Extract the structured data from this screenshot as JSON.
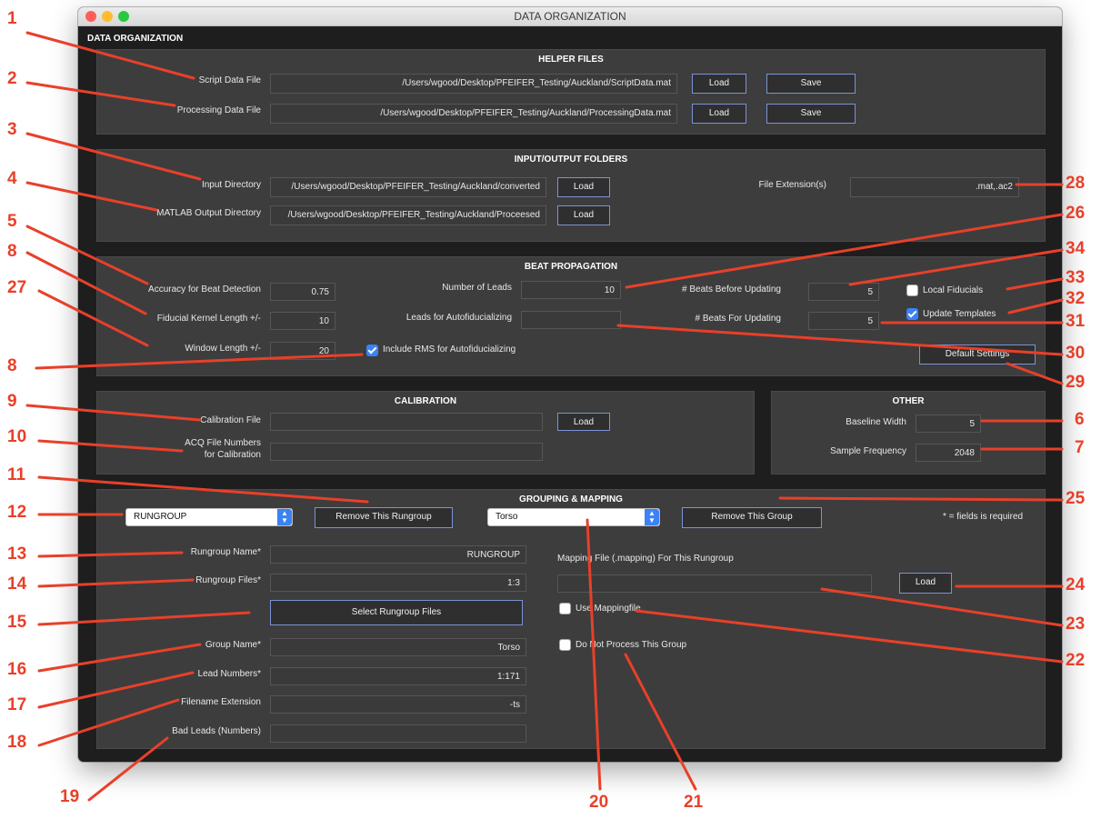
{
  "window": {
    "title": "DATA ORGANIZATION",
    "heading": "DATA ORGANIZATION"
  },
  "helper_files": {
    "title": "HELPER FILES",
    "script_label": "Script Data File",
    "script_path": "/Users/wgood/Desktop/PFEIFER_Testing/Auckland/ScriptData.mat",
    "processing_label": "Processing Data File",
    "processing_path": "/Users/wgood/Desktop/PFEIFER_Testing/Auckland/ProcessingData.mat",
    "load_label": "Load",
    "save_label": "Save"
  },
  "io_folders": {
    "title": "INPUT/OUTPUT FOLDERS",
    "input_label": "Input Directory",
    "input_path": "/Users/wgood/Desktop/PFEIFER_Testing/Auckland/converted",
    "output_label": "MATLAB Output Directory",
    "output_path": "/Users/wgood/Desktop/PFEIFER_Testing/Auckland/Proceesed",
    "ext_label": "File Extension(s)",
    "ext_value": ".mat,.ac2",
    "load_label": "Load"
  },
  "beat": {
    "title": "BEAT PROPAGATION",
    "accuracy_label": "Accuracy for Beat Detection",
    "accuracy_value": "0.75",
    "kernel_label": "Fiducial Kernel Length +/-",
    "kernel_value": "10",
    "window_label": "Window Length +/-",
    "window_value": "20",
    "leads_label": "Number of Leads",
    "leads_value": "10",
    "autofid_label": "Leads for Autofiducializing",
    "autofid_value": "",
    "rms_label": "Include RMS for Autofiducializing",
    "before_label": "# Beats Before Updating",
    "before_value": "5",
    "for_label": "# Beats For Updating",
    "for_value": "5",
    "local_label": "Local Fiducials",
    "update_label": "Update Templates",
    "default_label": "Default Settings"
  },
  "calibration": {
    "title": "CALIBRATION",
    "file_label": "Calibration File",
    "acq_label_1": "ACQ File Numbers",
    "acq_label_2": "for Calibration",
    "load_label": "Load"
  },
  "other": {
    "title": "OTHER",
    "baseline_label": "Baseline Width",
    "baseline_value": "5",
    "freq_label": "Sample Frequency",
    "freq_value": "2048"
  },
  "grouping": {
    "title": "GROUPING & MAPPING",
    "rungroup_select": "RUNGROUP",
    "remove_rungroup": "Remove This Rungroup",
    "group_select": "Torso",
    "remove_group": "Remove This Group",
    "required_note": "* = fields is required",
    "rg_name_label": "Rungroup Name*",
    "rg_name_value": "RUNGROUP",
    "rg_files_label": "Rungroup Files*",
    "rg_files_value": "1:3",
    "select_files": "Select Rungroup Files",
    "group_name_label": "Group Name*",
    "group_name_value": "Torso",
    "lead_numbers_label": "Lead Numbers*",
    "lead_numbers_value": "1:171",
    "filename_ext_label": "Filename Extension",
    "filename_ext_value": "-ts",
    "bad_leads_label": "Bad Leads (Numbers)",
    "mapping_label": "Mapping File (.mapping) For This Rungroup",
    "load_label": "Load",
    "use_mapping": "Use Mappingfile",
    "dont_process": "Do Not Process This Group"
  },
  "callouts": [
    "1",
    "2",
    "3",
    "4",
    "5",
    "8",
    "27",
    "8",
    "9",
    "10",
    "11",
    "12",
    "13",
    "14",
    "15",
    "16",
    "17",
    "18",
    "19",
    "20",
    "21",
    "22",
    "23",
    "24",
    "25",
    "6",
    "7",
    "29",
    "30",
    "31",
    "32",
    "33",
    "34",
    "26",
    "28"
  ],
  "colors": {
    "callout": "#e8402a",
    "accent": "#3b82f6",
    "panel": "#3d3d3d",
    "window": "#1e1e1e"
  }
}
